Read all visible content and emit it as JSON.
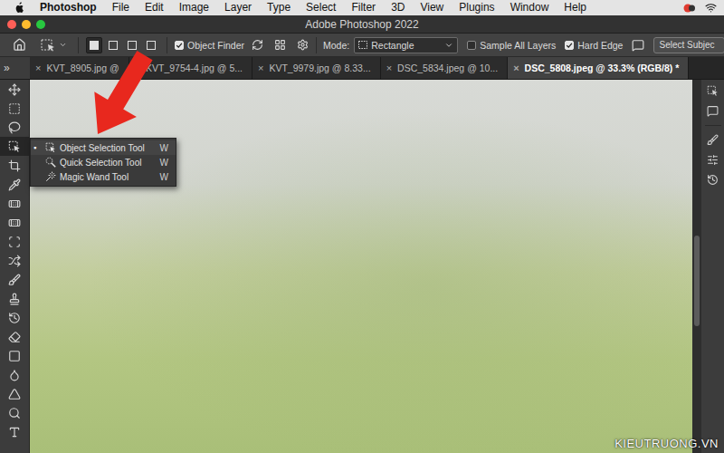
{
  "menubar": {
    "app": "Photoshop",
    "items": [
      "File",
      "Edit",
      "Image",
      "Layer",
      "Type",
      "Select",
      "Filter",
      "3D",
      "View",
      "Plugins",
      "Window",
      "Help"
    ]
  },
  "window": {
    "title": "Adobe Photoshop 2022"
  },
  "options_bar": {
    "selection_modes": [
      {
        "selected": true
      },
      {
        "selected": false
      },
      {
        "selected": false
      },
      {
        "selected": false
      }
    ],
    "object_finder": {
      "label": "Object Finder",
      "checked": true
    },
    "mode": {
      "label": "Mode:",
      "value": "Rectangle"
    },
    "sample_all_layers": {
      "label": "Sample All Layers",
      "checked": false
    },
    "hard_edge": {
      "label": "Hard Edge",
      "checked": true
    },
    "select_subject": "Select Subjec"
  },
  "panel_toggle": "»",
  "tabs": {
    "close": "×",
    "items": [
      {
        "label": "KVT_8905.jpg @",
        "selected": false
      },
      {
        "label": "KVT_9754-4.jpg @ 5...",
        "selected": false
      },
      {
        "label": "KVT_9979.jpg @ 8.33...",
        "selected": false
      },
      {
        "label": "DSC_5834.jpeg @ 10...",
        "selected": false
      },
      {
        "label": "DSC_5808.jpeg @ 33.3% (RGB/8) *",
        "selected": true
      }
    ]
  },
  "tools": [
    {
      "selected": false
    },
    {
      "selected": false
    },
    {
      "selected": false
    },
    {
      "selected": true
    },
    {
      "selected": false
    },
    {
      "selected": false
    },
    {
      "selected": false
    },
    {
      "selected": false
    },
    {
      "selected": false
    },
    {
      "selected": false
    },
    {
      "selected": false
    },
    {
      "selected": false
    },
    {
      "selected": false
    },
    {
      "selected": false
    },
    {
      "selected": false
    },
    {
      "selected": false
    },
    {
      "selected": false
    },
    {
      "selected": false
    },
    {
      "selected": false
    }
  ],
  "flyout": {
    "bullet": "▪",
    "items": [
      {
        "label": "Object Selection Tool",
        "shortcut": "W",
        "selected": true
      },
      {
        "label": "Quick Selection Tool",
        "shortcut": "W",
        "selected": false
      },
      {
        "label": "Magic Wand Tool",
        "shortcut": "W",
        "selected": false
      }
    ]
  },
  "watermark": "KIEUTRUONG.VN"
}
